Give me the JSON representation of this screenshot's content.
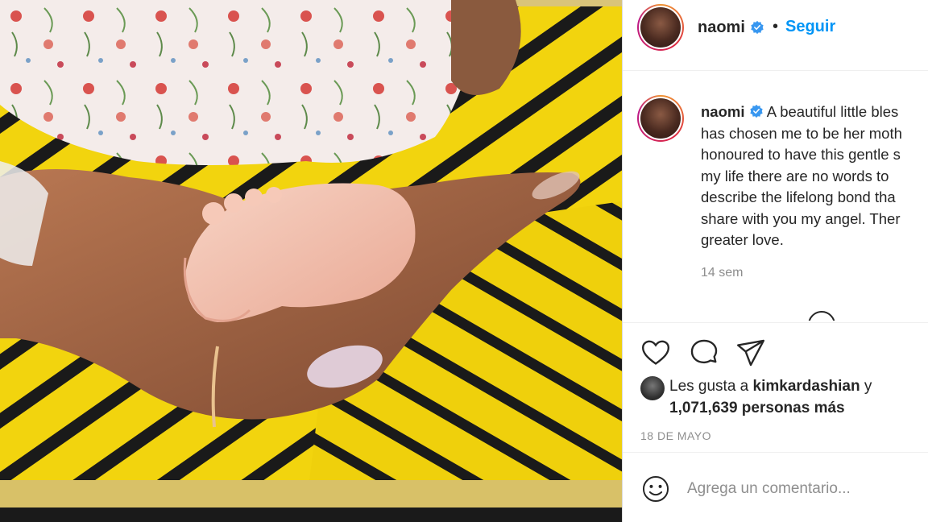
{
  "post": {
    "username": "naomi",
    "follow_label": "Seguir",
    "separator": "•"
  },
  "caption": {
    "username": "naomi",
    "lines": [
      "A beautiful little bles",
      "has chosen me to be her moth",
      "honoured to have this gentle s",
      "my life there are no words to",
      "describe the lifelong bond tha",
      "share with you my angel. Ther",
      "greater love."
    ],
    "time": "14 sem"
  },
  "likes": {
    "prefix": "Les gusta a",
    "liker": "kimkardashian",
    "conjunction": "y",
    "count_text": "1,071,639 personas más"
  },
  "date": "18 DE MAYO",
  "comment": {
    "placeholder": "Agrega un comentario..."
  },
  "icons": [
    "heart-icon",
    "comment-icon",
    "share-icon",
    "emoji-icon",
    "verified-icon"
  ],
  "colors": {
    "link_blue": "#0095f6",
    "verified_blue": "#3897f0",
    "text": "#262626",
    "muted": "#8e8e8e",
    "photo_yellow": "#f2d40e",
    "photo_skin": "#f3c6b4"
  }
}
